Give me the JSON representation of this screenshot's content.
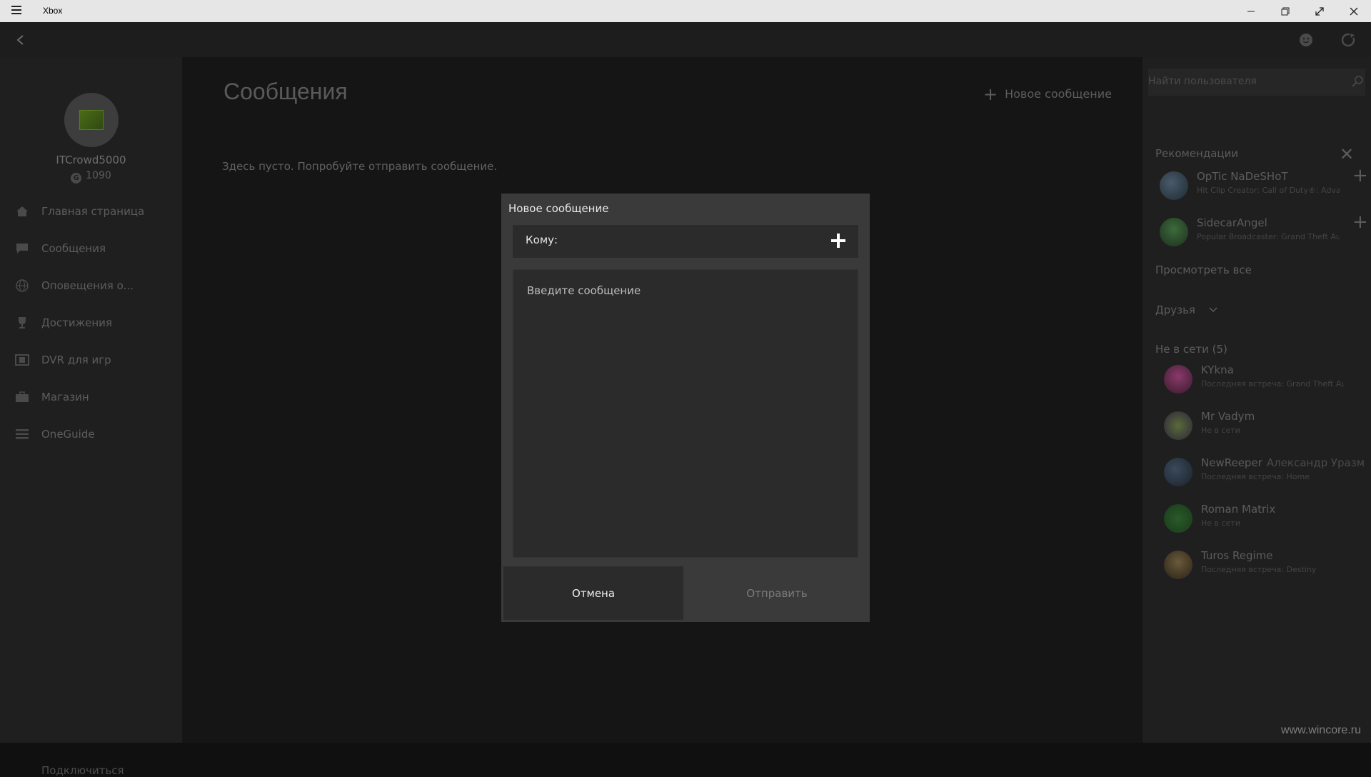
{
  "window": {
    "title": "Xbox",
    "controls": [
      "minimize-icon",
      "restore-icon",
      "fullscreen-icon",
      "close-icon"
    ]
  },
  "topbar": {
    "icons": [
      "back-arrow-icon",
      "smiley-icon",
      "refresh-icon"
    ]
  },
  "profile": {
    "gamertag": "ITCrowd5000",
    "gamerscore": "1090"
  },
  "sidebar": {
    "items": [
      {
        "label": "Главная страница",
        "icon": "home-icon"
      },
      {
        "label": "Сообщения",
        "icon": "chat-icon"
      },
      {
        "label": "Оповещения о...",
        "icon": "globe-icon"
      },
      {
        "label": "Достижения",
        "icon": "trophy-icon"
      },
      {
        "label": "DVR для игр",
        "icon": "film-icon"
      },
      {
        "label": "Магазин",
        "icon": "store-icon"
      },
      {
        "label": "OneGuide",
        "icon": "list-icon"
      }
    ],
    "connect_label": "Подключиться"
  },
  "main": {
    "title": "Сообщения",
    "new_message": "Новое сообщение",
    "empty_text": "Здесь пусто. Попробуйте отправить сообщение."
  },
  "right": {
    "search_placeholder": "Найти пользователя",
    "recommendations_title": "Рекомендации",
    "recommendations": [
      {
        "name": "OpTic NaDeSHoT",
        "sub": "Hit Clip Creator: Call of Duty®: Adva"
      },
      {
        "name": "SidecarAngel",
        "sub": "Popular Broadcaster: Grand Theft Au"
      }
    ],
    "see_all": "Просмотреть все",
    "friends_label": "Друзья",
    "offline_label": "Не в сети (5)",
    "friends": [
      {
        "name": "KYkna",
        "real": "",
        "sub": "Последняя встреча: Grand Theft Auto V"
      },
      {
        "name": "Mr Vadym",
        "real": "",
        "sub": "Не в сети"
      },
      {
        "name": "NewReeper",
        "real": "Александр Уразм",
        "sub": "Последняя встреча: Home"
      },
      {
        "name": "Roman Matrix",
        "real": "",
        "sub": "Не в сети"
      },
      {
        "name": "Turos Regime",
        "real": "",
        "sub": "Последняя встреча: Destiny"
      }
    ]
  },
  "dialog": {
    "title": "Новое сообщение",
    "to_label": "Кому:",
    "message_placeholder": "Введите сообщение",
    "cancel": "Отмена",
    "send": "Отправить"
  },
  "watermark": "www.wincore.ru",
  "colors": {
    "dialog_bg": "#3a3a3a",
    "field_bg": "#2b2b2b",
    "app_bg": "#151515"
  }
}
